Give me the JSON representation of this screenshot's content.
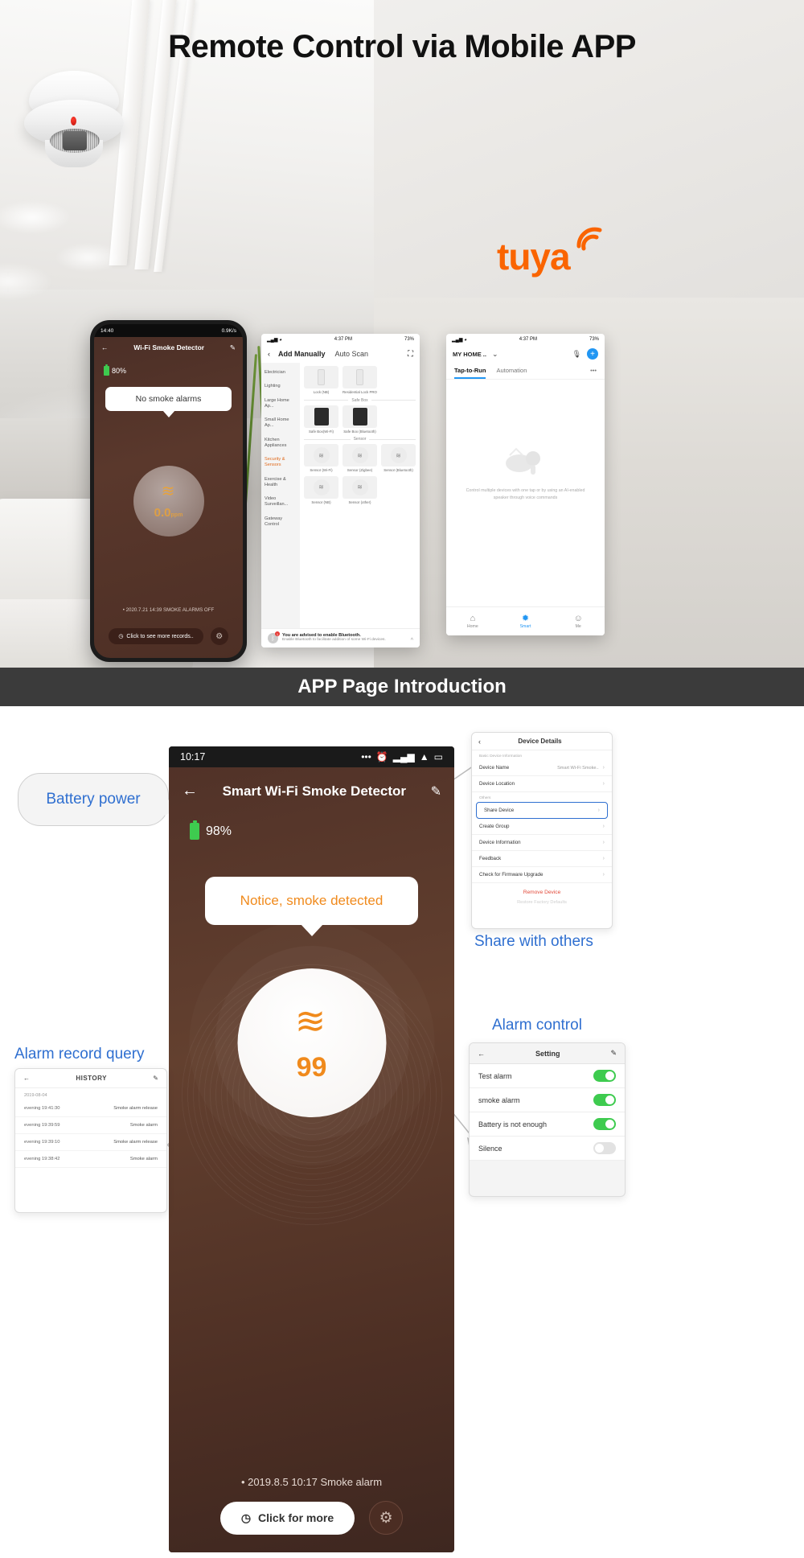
{
  "hero": {
    "title": "Remote Control via Mobile APP",
    "brand_logo": "tuya"
  },
  "phone1": {
    "status": {
      "time": "14:40",
      "speed": "0.9K/s",
      "battery": "80"
    },
    "nav": {
      "back_icon": "back-arrow-icon",
      "title": "Wi-Fi Smoke Detector",
      "edit_icon": "edit-pencil-icon"
    },
    "battery_label": "80%",
    "bubble": "No smoke alarms",
    "dial": {
      "icon": "smoke-wave-icon",
      "value": "0.0",
      "unit": "ppm"
    },
    "record": "• 2020.7.21 14:39  SMOKE ALARMS OFF",
    "more_button": "Click to see more records..",
    "gear_icon": "gear-icon"
  },
  "phone2": {
    "status": {
      "time": "4:37 PM",
      "battery": "73%"
    },
    "header": {
      "back_icon": "back-chevron-icon",
      "title": "Add Manually",
      "alt_tab": "Auto Scan",
      "scan_icon": "scan-frame-icon"
    },
    "categories": [
      "Electrician",
      "Lighting",
      "Large Home Ap...",
      "Small Home Ap...",
      "Kitchen Appliances",
      "Security & Sensors",
      "Exercise & Health",
      "Video Surveillan...",
      "Gateway Control"
    ],
    "active_category": "Security & Sensors",
    "rows": [
      {
        "section": "",
        "items": [
          {
            "label": "Lock (NB)",
            "thumb": "device-strip"
          },
          {
            "label": "Residential Lock PRO",
            "thumb": "device-strip"
          }
        ]
      },
      {
        "section": "Safe Box",
        "items": [
          {
            "label": "Safe Box(Wi-Fi)",
            "thumb": "black-box"
          },
          {
            "label": "Safe Box (Bluetooth)",
            "thumb": "black-box"
          }
        ]
      },
      {
        "section": "Sensor",
        "items": [
          {
            "label": "Sensor (Wi-Fi)",
            "thumb": "wave-circle"
          },
          {
            "label": "Sensor (Zigbee)",
            "thumb": "wave-circle"
          },
          {
            "label": "Sensor (Bluetooth)",
            "thumb": "wave-circle"
          }
        ]
      },
      {
        "section": "",
        "items": [
          {
            "label": "Sensor (NB)",
            "thumb": "wave-circle"
          },
          {
            "label": "Sensor (other)",
            "thumb": "wave-circle"
          }
        ]
      }
    ],
    "bluetooth_notice": {
      "icon": "bluetooth-icon",
      "badge": "1",
      "title": "You are advised to enable Bluetooth.",
      "body": "Enable Bluetooth to facilitate addition of some Wi-Fi devices.",
      "collapse_icon": "chevron-up-icon"
    }
  },
  "phone3": {
    "status": {
      "time": "4:37 PM",
      "battery": "73%"
    },
    "home_label": "MY HOME ..",
    "chevron_icon": "chevron-down-icon",
    "mic_icon": "mic-icon",
    "add_icon": "plus-icon",
    "tabs": [
      "Tap-to-Run",
      "Automation"
    ],
    "active_tab": "Tap-to-Run",
    "more_icon": "ellipsis-icon",
    "empty_hint": "Control multiple devices with one tap or by using an AI-enabled speaker through voice commands",
    "bottom_nav": [
      {
        "label": "Home",
        "icon": "home-icon"
      },
      {
        "label": "Smart",
        "icon": "smart-icon"
      },
      {
        "label": "Me",
        "icon": "person-icon"
      }
    ],
    "active_nav": "Smart"
  },
  "banner": {
    "title": "APP Page Introduction"
  },
  "bigphone": {
    "status": {
      "time": "10:17",
      "icons": "alarm-signal-wifi-battery"
    },
    "nav": {
      "back_icon": "back-arrow-icon",
      "title": "Smart Wi-Fi Smoke Detector",
      "edit_icon": "edit-pencil-icon"
    },
    "battery_label": "98%",
    "bubble": "Notice, smoke detected",
    "dial": {
      "icon": "smoke-wave-icon",
      "value": "99"
    },
    "record": "• 2019.8.5 10:17 Smoke alarm",
    "more_button": "Click for more",
    "clock_icon": "clock-icon",
    "gear_icon": "gear-icon"
  },
  "callouts": {
    "battery_power": "Battery power",
    "share_with_others": "Share with others",
    "alarm_control": "Alarm control",
    "alarm_record_query": "Alarm record query"
  },
  "device_details": {
    "back_icon": "back-chevron-icon",
    "title": "Device Details",
    "section1": "Basic Device Information",
    "section2": "Others",
    "rows": [
      {
        "label": "Device Name",
        "value": "Smart Wi-Fi Smoke..",
        "chevron": true
      },
      {
        "label": "Device Location",
        "value": "",
        "chevron": true
      },
      {
        "label": "Share Device",
        "value": "",
        "chevron": true,
        "highlight": true
      },
      {
        "label": "Create Group",
        "value": "",
        "chevron": true
      },
      {
        "label": "Device Information",
        "value": "",
        "chevron": true
      },
      {
        "label": "Feedback",
        "value": "",
        "chevron": true
      },
      {
        "label": "Check for Firmware Upgrade",
        "value": "",
        "chevron": true
      }
    ],
    "remove": "Remove Device",
    "restore": "Restore Factory Defaults"
  },
  "setting_panel": {
    "back_icon": "back-arrow-icon",
    "title": "Setting",
    "edit_icon": "edit-pencil-icon",
    "rows": [
      {
        "label": "Test alarm",
        "on": true
      },
      {
        "label": "smoke alarm",
        "on": true
      },
      {
        "label": "Battery is not enough",
        "on": true
      },
      {
        "label": "Silence",
        "on": false
      }
    ]
  },
  "history_panel": {
    "back_icon": "back-arrow-icon",
    "title": "HISTORY",
    "edit_icon": "edit-pencil-icon",
    "date": "2019-08-04",
    "rows": [
      {
        "time": "evening 19:41:30",
        "event": "Smoke alarm release"
      },
      {
        "time": "evening 19:39:59",
        "event": "Smoke alarm"
      },
      {
        "time": "evening 19:39:10",
        "event": "Smoke alarm release"
      },
      {
        "time": "evening 19:38:42",
        "event": "Smoke alarm"
      }
    ]
  }
}
